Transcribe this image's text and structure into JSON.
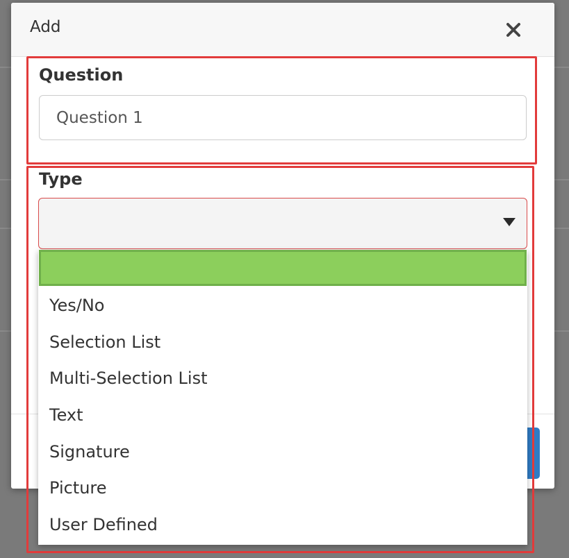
{
  "modal": {
    "title": "Add"
  },
  "question": {
    "label": "Question",
    "value": "Question 1"
  },
  "type": {
    "label": "Type",
    "selected_value": "",
    "options": [
      "",
      "Yes/No",
      "Selection List",
      "Multi-Selection List",
      "Text",
      "Signature",
      "Picture",
      "User Defined"
    ]
  },
  "colors": {
    "highlight_border": "#e23b3b",
    "selected_option": "#8ccf5c",
    "footer_button": "#2f7bc4"
  }
}
